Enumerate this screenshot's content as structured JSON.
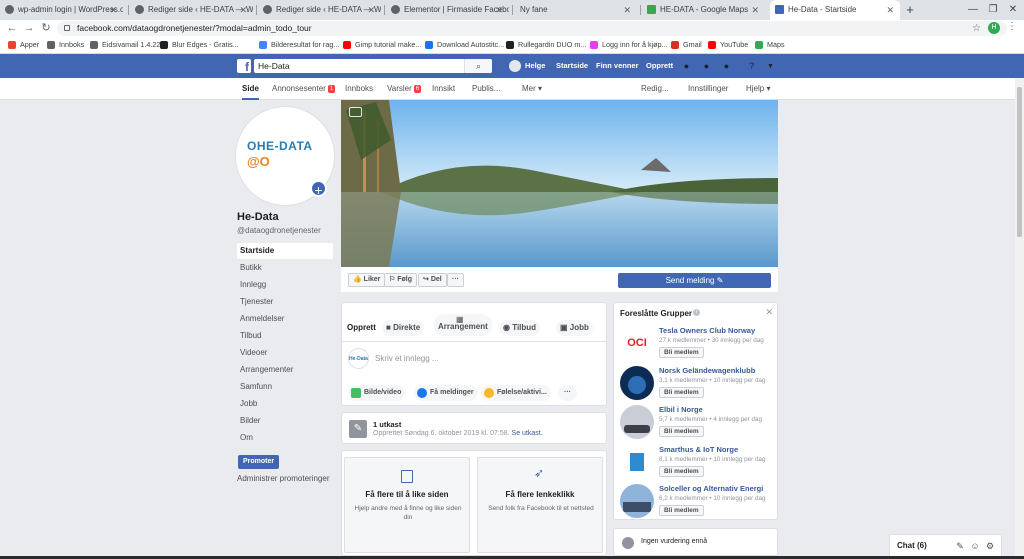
{
  "browser": {
    "tabs": [
      {
        "title": "wp-admin login | WordPress.org"
      },
      {
        "title": "Rediger side ‹ HE-DATA — Word"
      },
      {
        "title": "Rediger side ‹ HE-DATA — Word"
      },
      {
        "title": "Elementor | Firmaside Facebook"
      },
      {
        "title": "Ny fane"
      },
      {
        "title": "HE-DATA - Google Maps"
      },
      {
        "title": "He-Data - Startside"
      }
    ],
    "url": "facebook.com/dataogdronetjenester/?modal=admin_todo_tour",
    "profile_initial": "H",
    "bookmarks": [
      {
        "label": "Apper",
        "color": "#ea4335"
      },
      {
        "label": "Innboks",
        "color": "#5f6368"
      },
      {
        "label": "Eidsivamail 1.4.22",
        "color": "#5f6368"
      },
      {
        "label": "Blur Edges - Gratis...",
        "color": "#202124"
      },
      {
        "label": "Bilderesultat for rag...",
        "color": "#4285f4"
      },
      {
        "label": "Gimp tutorial make...",
        "color": "#ff0000"
      },
      {
        "label": "Download Autostitc...",
        "color": "#1a73e8"
      },
      {
        "label": "Rullegardin DUO m...",
        "color": "#202124"
      },
      {
        "label": "Logg inn for å kjøp...",
        "color": "#e040fb"
      },
      {
        "label": "Gmail",
        "color": "#d93025"
      },
      {
        "label": "YouTube",
        "color": "#ff0000"
      },
      {
        "label": "Maps",
        "color": "#34a853"
      }
    ]
  },
  "fb_header": {
    "logo": "f",
    "search_value": "He-Data",
    "user": "Helge",
    "links": [
      "Startside",
      "Finn venner",
      "Opprett"
    ]
  },
  "page_nav": {
    "items": [
      {
        "label": "Side"
      },
      {
        "label": "Annonsesenter",
        "badge": "1"
      },
      {
        "label": "Innboks"
      },
      {
        "label": "Varsler",
        "badge": "6"
      },
      {
        "label": "Innsikt"
      },
      {
        "label": "Publis..."
      },
      {
        "label": "Mer ▾"
      }
    ],
    "right": [
      "Redig...",
      "Innstillinger",
      "Hjelp ▾"
    ]
  },
  "page": {
    "logo_line1": "OHE-DATA",
    "logo_line2": "@O",
    "name": "He-Data",
    "handle": "@dataogdronetjenester",
    "sidebar": [
      "Startside",
      "Butikk",
      "Innlegg",
      "Tjenester",
      "Anmeldelser",
      "Tilbud",
      "Videoer",
      "Arrangementer",
      "Samfunn",
      "Jobb",
      "Bilder",
      "Om"
    ],
    "promote": "Promoter",
    "manage_promotions": "Administrer promoteringer"
  },
  "actions": {
    "like": "Liker",
    "follow": "Følg",
    "share": "Del",
    "more": "···",
    "send_message": "Send melding ✎"
  },
  "composer": {
    "tabs": [
      "Opprett",
      "Direkte",
      "Arrangement",
      "Tilbud",
      "Jobb"
    ],
    "placeholder": "Skriv et innlegg ...",
    "avatar_text": "He-Data",
    "buttons": [
      "Bilde/video",
      "Få meldinger",
      "Følelse/aktivi...",
      "···"
    ]
  },
  "draft": {
    "title": "1 utkast",
    "text": "Opprettet Søndag 6. oktober 2019 kl. 07:58.",
    "link": "Se utkast."
  },
  "promo_cards": [
    {
      "title": "Få flere til å like siden",
      "desc": "Hjelp andre med å finne og like siden din"
    },
    {
      "title": "Få flere lenkeklikk",
      "desc": "Send folk fra Facebook til et nettsted"
    }
  ],
  "groups": {
    "title": "Foreslåtte Grupper",
    "join_label": "Bli medlem",
    "items": [
      {
        "name": "Tesla Owners Club Norway",
        "meta": "27 k medlemmer • 30 innlegg per dag"
      },
      {
        "name": "Norsk Geländewagenklubb",
        "meta": "3,1 k medlemmer • 10 innlegg per dag"
      },
      {
        "name": "Elbil i Norge",
        "meta": "5,7 k medlemmer • 4 innlegg per dag"
      },
      {
        "name": "Smarthus & IoT Norge",
        "meta": "8,1 k medlemmer • 10 innlegg per dag"
      },
      {
        "name": "Solceller og Alternativ Energi",
        "meta": "6,2 k medlemmer • 10 innlegg per dag"
      }
    ]
  },
  "rating": "Ingen vurdering ennå",
  "chat": {
    "label": "Chat (6)"
  }
}
